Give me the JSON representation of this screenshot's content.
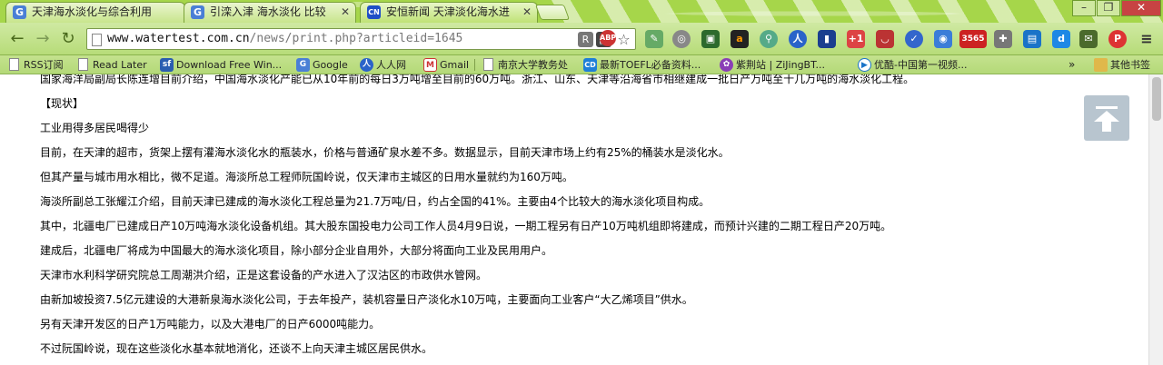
{
  "tabs": [
    {
      "title": "天津海水淡化与综合利用",
      "icon": "G"
    },
    {
      "title": "引滦入津 海水淡化 比较",
      "icon": "G"
    },
    {
      "title": "安恒新闻 天津淡化海水进",
      "icon": "CN"
    }
  ],
  "address_bar": {
    "host": "www.watertest.com.cn",
    "path": "/news/print.php?articleid=1645"
  },
  "extensions": [
    "ABP",
    "3565"
  ],
  "bookmarks": [
    {
      "label": "RSS订阅"
    },
    {
      "label": "Read Later"
    },
    {
      "label": "Download Free Win..."
    },
    {
      "label": "Google"
    },
    {
      "label": "人人网"
    },
    {
      "label": "Gmail"
    },
    {
      "label": "南京大学教务处"
    },
    {
      "label": "最新TOEFL必备资料..."
    },
    {
      "label": "紫荆站 | ZiJingBT..."
    },
    {
      "label": "优酷-中国第一视频..."
    },
    {
      "label": "其他书签"
    }
  ],
  "bookmarks_overflow": "»",
  "article": {
    "paragraphs": [
      "国家海洋局副局长陈连增目前介绍，中国海水淡化产能已从10年前的每日3万吨增至目前的60万吨。浙江、山东、天津等沿海省市相继建成一批日产万吨至十几万吨的海水淡化工程。",
      "【现状】",
      "工业用得多居民喝得少",
      "目前，在天津的超市，货架上摆有灌海水淡化水的瓶装水，价格与普通矿泉水差不多。数据显示，目前天津市场上约有25%的桶装水是淡化水。",
      "但其产量与城市用水相比，微不足道。海淡所总工程师阮国岭说，仅天津市主城区的日用水量就约为160万吨。",
      "海淡所副总工张耀江介绍，目前天津已建成的海水淡化工程总量为21.7万吨/日，约占全国的41%。主要由4个比较大的海水淡化项目构成。",
      "其中，北疆电厂已建成日产10万吨海水淡化设备机组。其大股东国投电力公司工作人员4月9日说，一期工程另有日产10万吨机组即将建成，而预计兴建的二期工程日产20万吨。",
      "建成后，北疆电厂将成为中国最大的海水淡化项目，除小部分企业自用外，大部分将面向工业及民用用户。",
      "天津市水利科学研究院总工周潮洪介绍，正是这套设备的产水进入了汉沽区的市政供水管网。",
      "由新加坡投资7.5亿元建设的大港新泉海水淡化公司，于去年投产，装机容量日产淡化水10万吨，主要面向工业客户“大乙烯项目”供水。",
      "另有天津开发区的日产1万吨能力，以及大港电厂的日产6000吨能力。",
      "不过阮国岭说，现在这些淡化水基本就地消化，还谈不上向天津主城区居民供水。"
    ]
  }
}
